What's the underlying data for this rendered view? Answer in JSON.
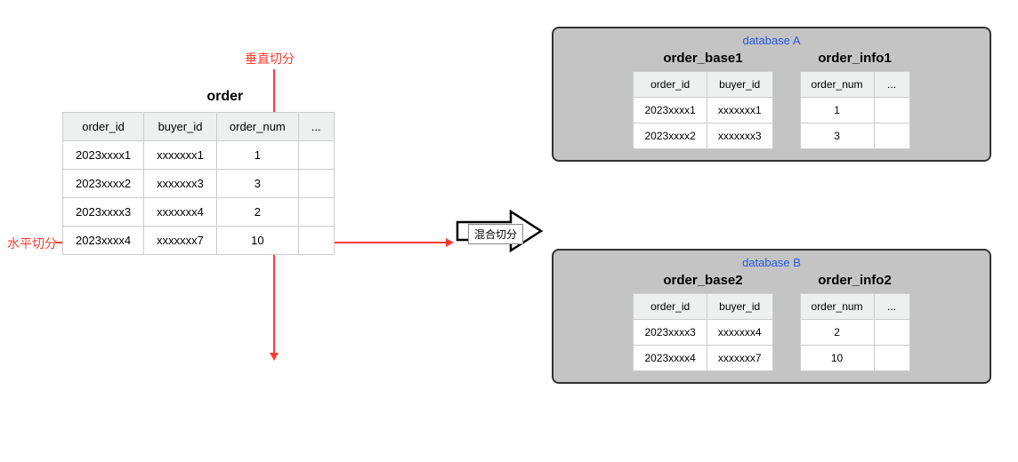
{
  "labels": {
    "vertical_split": "垂直切分",
    "horizontal_split": "水平切分",
    "mixed_split": "混合切分"
  },
  "source_table": {
    "title": "order",
    "headers": {
      "c0": "order_id",
      "c1": "buyer_id",
      "c2": "order_num",
      "c3": "..."
    },
    "rows": [
      {
        "c0": "2023xxxx1",
        "c1": "xxxxxxx1",
        "c2": "1",
        "c3": ""
      },
      {
        "c0": "2023xxxx2",
        "c1": "xxxxxxx3",
        "c2": "3",
        "c3": ""
      },
      {
        "c0": "2023xxxx3",
        "c1": "xxxxxxx4",
        "c2": "2",
        "c3": ""
      },
      {
        "c0": "2023xxxx4",
        "c1": "xxxxxxx7",
        "c2": "10",
        "c3": ""
      }
    ]
  },
  "db_a": {
    "label": "database A",
    "base": {
      "title": "order_base1",
      "headers": {
        "c0": "order_id",
        "c1": "buyer_id"
      },
      "rows": [
        {
          "c0": "2023xxxx1",
          "c1": "xxxxxxx1"
        },
        {
          "c0": "2023xxxx2",
          "c1": "xxxxxxx3"
        }
      ]
    },
    "info": {
      "title": "order_info1",
      "headers": {
        "c0": "order_num",
        "c1": "..."
      },
      "rows": [
        {
          "c0": "1",
          "c1": ""
        },
        {
          "c0": "3",
          "c1": ""
        }
      ]
    }
  },
  "db_b": {
    "label": "database B",
    "base": {
      "title": "order_base2",
      "headers": {
        "c0": "order_id",
        "c1": "buyer_id"
      },
      "rows": [
        {
          "c0": "2023xxxx3",
          "c1": "xxxxxxx4"
        },
        {
          "c0": "2023xxxx4",
          "c1": "xxxxxxx7"
        }
      ]
    },
    "info": {
      "title": "order_info2",
      "headers": {
        "c0": "order_num",
        "c1": "..."
      },
      "rows": [
        {
          "c0": "2",
          "c1": ""
        },
        {
          "c0": "10",
          "c1": ""
        }
      ]
    }
  }
}
